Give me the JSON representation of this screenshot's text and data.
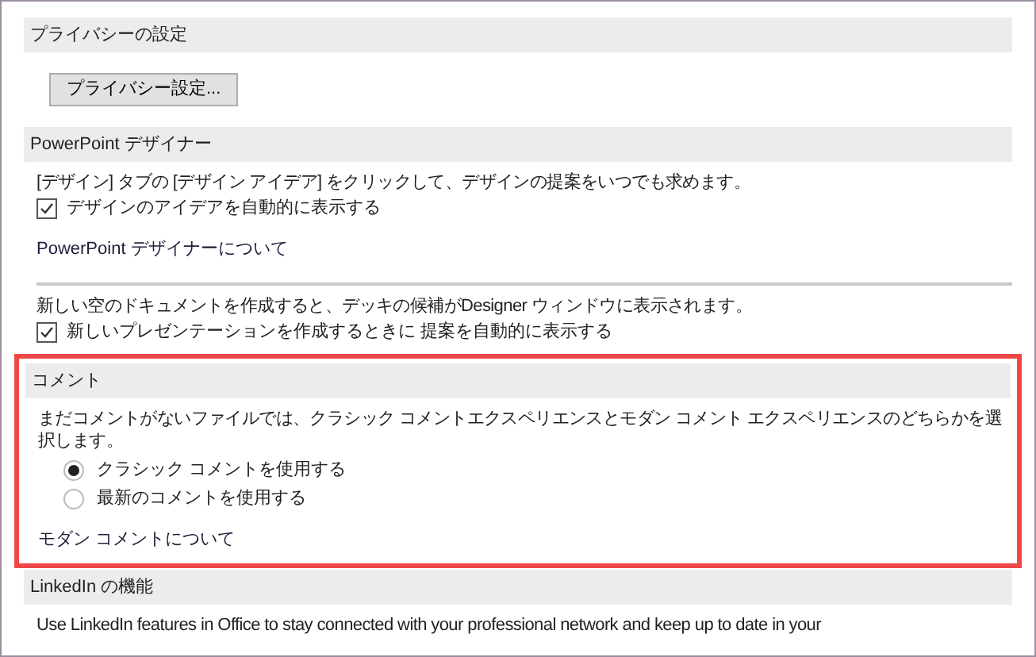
{
  "sections": [
    {
      "title": "プライバシーの設定",
      "highlighted": false,
      "items": [
        {
          "kind": "button",
          "label": "プライバシー設定..."
        }
      ]
    },
    {
      "title": "PowerPoint デザイナー",
      "highlighted": false,
      "items": [
        {
          "kind": "text",
          "text": "[デザイン] タブの [デザイン アイデア] をクリックして、デザインの提案をいつでも求めます。"
        },
        {
          "kind": "checkbox",
          "label": "デザインのアイデアを自動的に表示する",
          "checked": true
        },
        {
          "kind": "link",
          "text": "PowerPoint デザイナーについて"
        },
        {
          "kind": "divider"
        },
        {
          "kind": "text",
          "text": "新しい空のドキュメントを作成すると、デッキの候補がDesigner ウィンドウに表示されます。"
        },
        {
          "kind": "checkbox",
          "label": "新しいプレゼンテーションを作成するときに 提案を自動的に表示する",
          "checked": true
        }
      ]
    },
    {
      "title": "コメント",
      "highlighted": true,
      "items": [
        {
          "kind": "text",
          "text": "まだコメントがないファイルでは、クラシック コメントエクスペリエンスとモダン コメント エクスペリエンスのどちらかを選択します。"
        },
        {
          "kind": "radio",
          "label": "クラシック コメントを使用する",
          "selected": true
        },
        {
          "kind": "radio",
          "label": "最新のコメントを使用する",
          "selected": false
        },
        {
          "kind": "link",
          "text": "モダン コメントについて"
        }
      ]
    },
    {
      "title": "LinkedIn の機能",
      "highlighted": false,
      "items": [
        {
          "kind": "text",
          "text": "Use LinkedIn features in Office to stay connected with your professional network and keep up to date in your"
        }
      ]
    }
  ]
}
